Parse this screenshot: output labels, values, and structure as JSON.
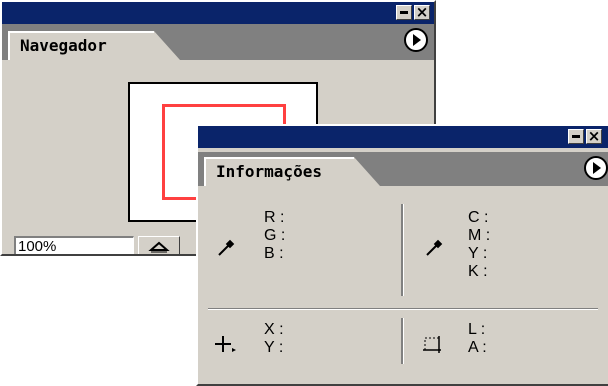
{
  "navigator": {
    "tab_label": "Navegador",
    "zoom_value": "100%",
    "menu_icon": "play-right-icon",
    "zoom_out_icon": "mountain-small-icon"
  },
  "info": {
    "tab_label": "Informações",
    "rgb_labels": [
      "R :",
      "G :",
      "B :"
    ],
    "cmyk_labels": [
      "C :",
      "M :",
      "Y :",
      "K :"
    ],
    "xy_labels": [
      "X :",
      "Y :"
    ],
    "la_labels": [
      "L :",
      "A :"
    ],
    "icons": [
      "eyedropper-icon",
      "eyedropper-icon",
      "crosshair-icon",
      "selection-size-icon"
    ]
  },
  "colors": {
    "titlebar": "#0a246a",
    "panel": "#d4d0c8",
    "tab_strip": "#808080",
    "view_box": "#ff4040"
  }
}
